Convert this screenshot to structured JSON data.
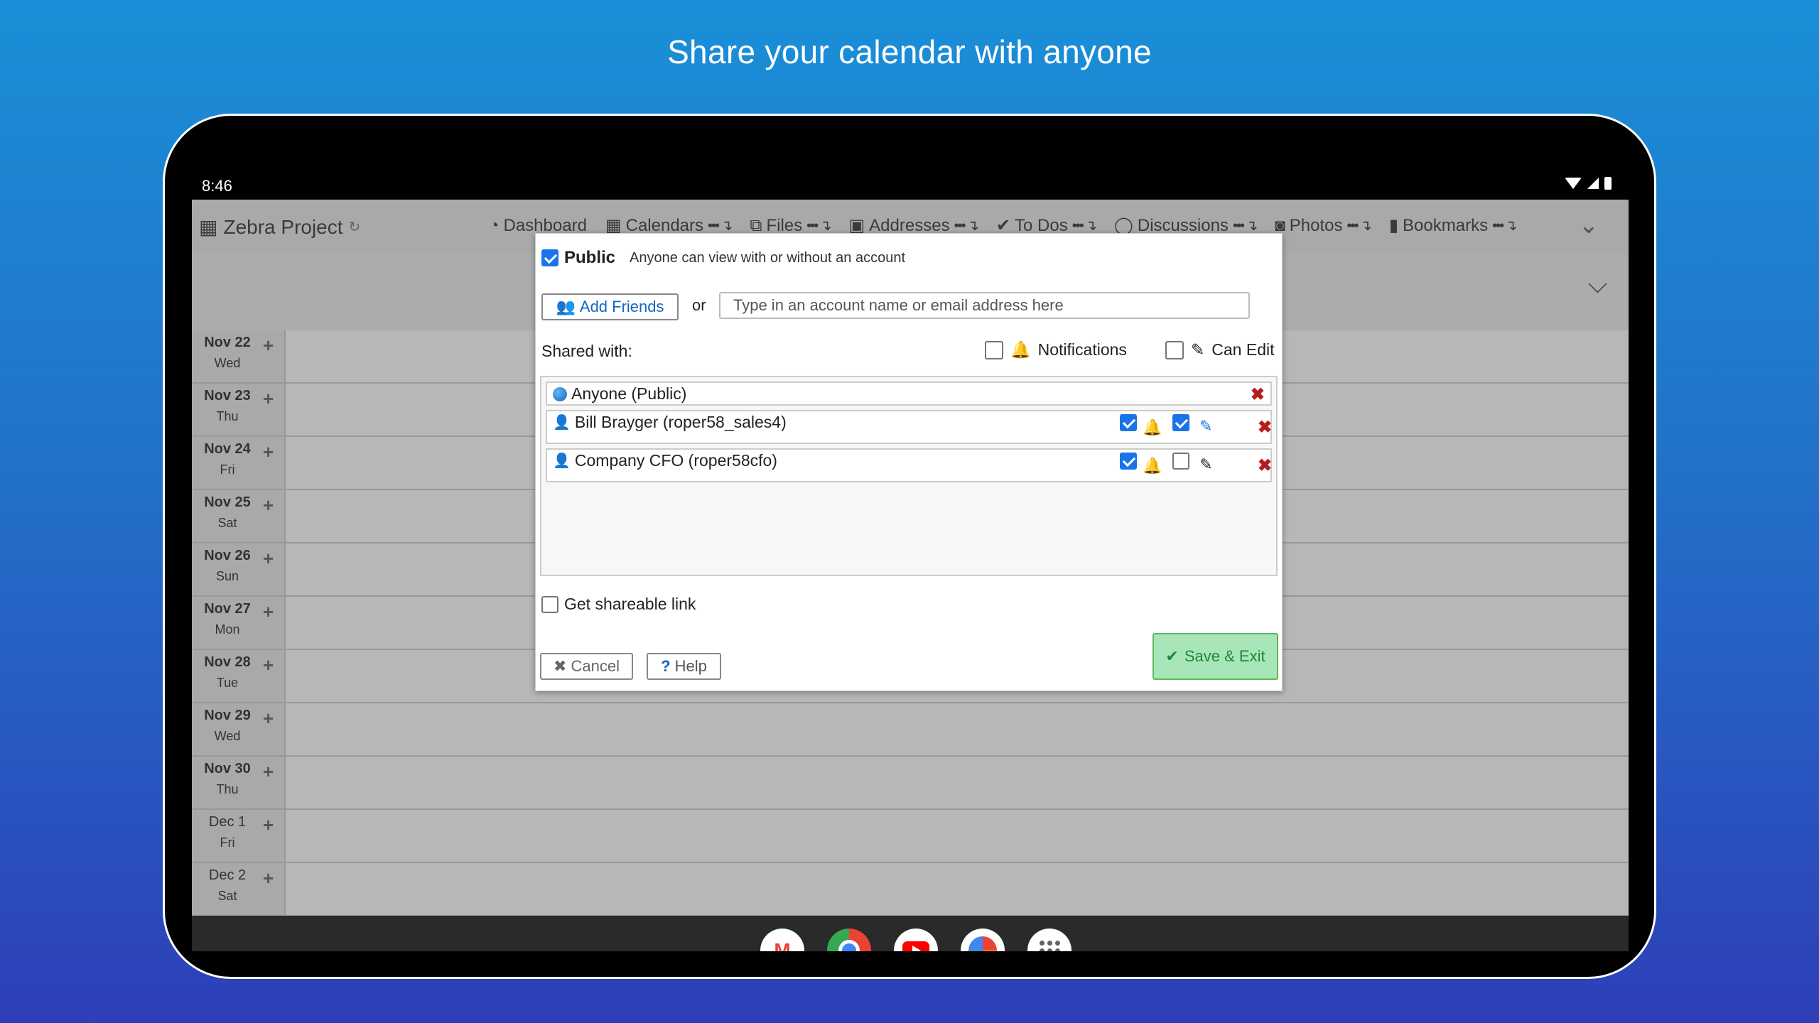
{
  "promo": {
    "headline": "Share your calendar with anyone"
  },
  "status": {
    "time": "8:46"
  },
  "app": {
    "title": "Zebra Project",
    "nav": [
      {
        "label": "Dashboard",
        "icon": "dashboard-icon",
        "menu": false
      },
      {
        "label": "Calendars",
        "icon": "calendar-icon",
        "menu": true
      },
      {
        "label": "Files",
        "icon": "files-icon",
        "menu": true
      },
      {
        "label": "Addresses",
        "icon": "address-book-icon",
        "menu": true
      },
      {
        "label": "To Dos",
        "icon": "check-icon",
        "menu": true
      },
      {
        "label": "Discussions",
        "icon": "comment-icon",
        "menu": true
      },
      {
        "label": "Photos",
        "icon": "camera-icon",
        "menu": true
      },
      {
        "label": "Bookmarks",
        "icon": "bookmark-icon",
        "menu": true
      }
    ],
    "days": [
      {
        "date": "Nov 22",
        "dow": "Wed"
      },
      {
        "date": "Nov 23",
        "dow": "Thu"
      },
      {
        "date": "Nov 24",
        "dow": "Fri"
      },
      {
        "date": "Nov 25",
        "dow": "Sat"
      },
      {
        "date": "Nov 26",
        "dow": "Sun"
      },
      {
        "date": "Nov 27",
        "dow": "Mon"
      },
      {
        "date": "Nov 28",
        "dow": "Tue"
      },
      {
        "date": "Nov 29",
        "dow": "Wed"
      },
      {
        "date": "Nov 30",
        "dow": "Thu"
      },
      {
        "date": "Dec 1",
        "dow": "Fri"
      },
      {
        "date": "Dec 2",
        "dow": "Sat"
      }
    ]
  },
  "dialog": {
    "public_label": "Public",
    "public_checked": true,
    "public_desc": "Anyone can view with or without an account",
    "add_friends": "Add Friends",
    "or": "or",
    "account_placeholder": "Type in an account name or email address here",
    "shared_with": "Shared with:",
    "notifications": "Notifications",
    "can_edit": "Can Edit",
    "rows": [
      {
        "name": "Anyone (Public)",
        "type": "public"
      },
      {
        "name": "Bill Brayger (roper58_sales4)",
        "type": "user",
        "notify": true,
        "edit": true
      },
      {
        "name": "Company CFO (roper58cfo)",
        "type": "user",
        "notify": true,
        "edit": false
      }
    ],
    "shareable_link": "Get shareable link",
    "cancel": "Cancel",
    "help": "Help",
    "save": "Save & Exit"
  },
  "colors": {
    "accent": "#1a73e8",
    "danger": "#b71c1c",
    "save_bg": "#a8e6b9",
    "save_fg": "#218838"
  }
}
